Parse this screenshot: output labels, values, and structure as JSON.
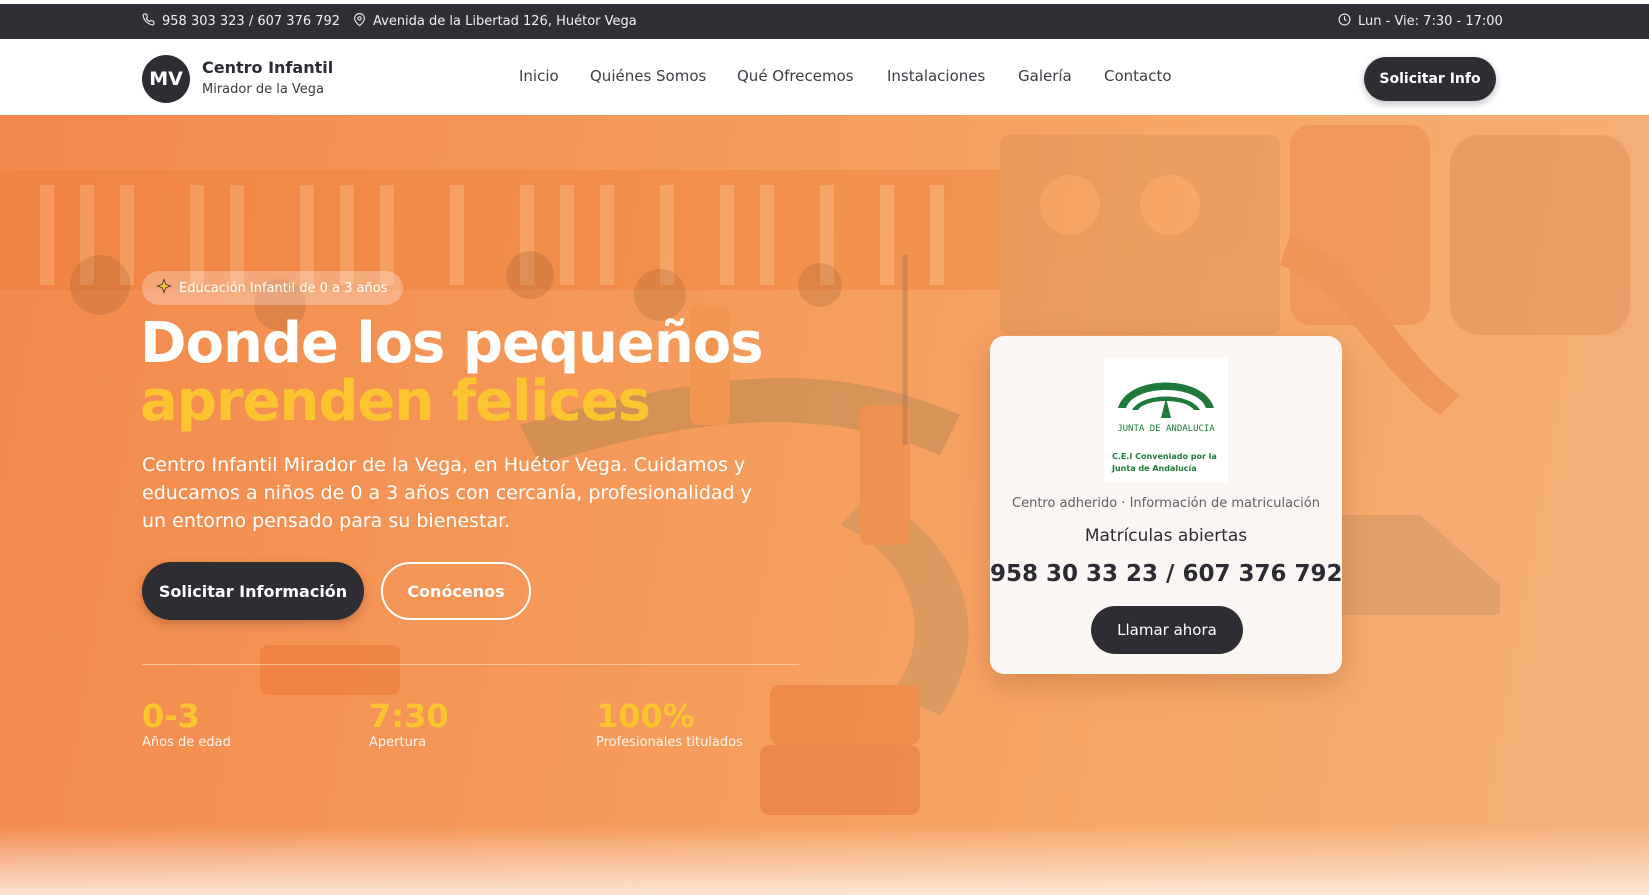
{
  "topbar": {
    "phone_icon": "phone-icon",
    "phones": "958 303 323 / 607 376 792",
    "location_icon": "map-pin-icon",
    "address": "Avenida de la Libertad 126, Huétor Vega",
    "clock_icon": "clock-icon",
    "hours": "Lun - Vie: 7:30 - 17:00"
  },
  "header": {
    "logo_initials": "MV",
    "logo_title": "Centro Infantil",
    "logo_subtitle": "Mirador de la Vega",
    "nav": [
      "Inicio",
      "Quiénes Somos",
      "Qué Ofrecemos",
      "Instalaciones",
      "Galería",
      "Contacto"
    ],
    "cta": "Solicitar Info"
  },
  "hero": {
    "badge_icon": "sparkles-icon",
    "badge": "Educación Infantil de 0 a 3 años",
    "title_line1": "Donde los pequeños",
    "title_line2": "aprenden felices",
    "lead": "Centro Infantil Mirador de la Vega, en Huétor Vega. Cuidamos y educamos a niños de 0 a 3 años con cercanía, profesionalidad y un entorno pensado para su bienestar.",
    "primary_button": "Solicitar Información",
    "secondary_button": "Conócenos",
    "stats": [
      {
        "value": "0-3",
        "label": "Años de edad"
      },
      {
        "value": "7:30",
        "label": "Apertura"
      },
      {
        "value": "100%",
        "label": "Profesionales titulados"
      }
    ]
  },
  "card": {
    "logo_text": "JUNTA DE ANDALUCIA",
    "logo_caption_1": "C.E.I Conveniado por la",
    "logo_caption_2": "Junta de Andalucía",
    "subtitle": "Centro adherido · Información de matriculación",
    "title": "Matrículas abiertas",
    "phones": "958 30 33 23 / 607 376 792",
    "button": "Llamar ahora"
  },
  "colors": {
    "topbar_bg": "#2f2f35",
    "dark_button": "#2d2d33",
    "hero_orange": "#f59a5a",
    "accent_yellow": "#fbc52f",
    "junta_green": "#1f7a3a"
  }
}
